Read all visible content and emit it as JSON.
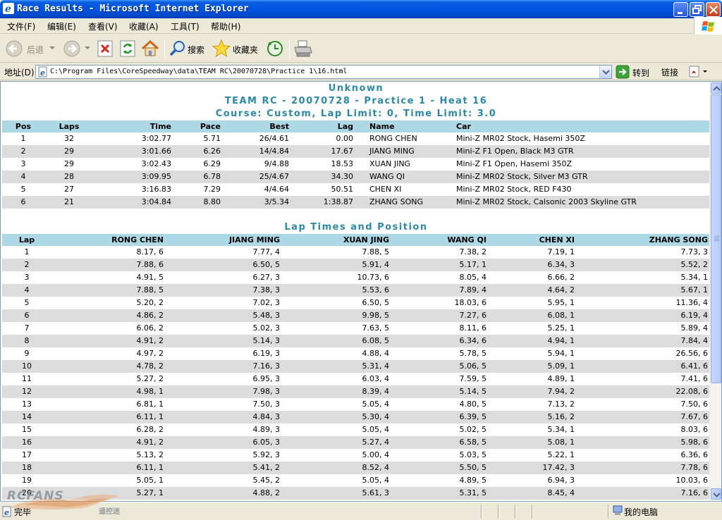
{
  "window": {
    "title": "Race Results - Microsoft Internet Explorer"
  },
  "menu": {
    "items": [
      "文件(F)",
      "编辑(E)",
      "查看(V)",
      "收藏(A)",
      "工具(T)",
      "帮助(H)"
    ]
  },
  "toolbar": {
    "back_label": "后退",
    "search_label": "搜索",
    "favorites_label": "收藏夹"
  },
  "address": {
    "label": "地址(D)",
    "value": "C:\\Program Files\\CoreSpeedway\\data\\TEAM RC\\20070728\\Practice 1\\16.html",
    "go_label": "转到",
    "links_label": "链接"
  },
  "page": {
    "title1": "Unknown",
    "title2": "TEAM RC - 20070728 - Practice 1 - Heat 16",
    "title3": "Course: Custom, Lap Limit: 0, Time Limit: 3.0",
    "results_headers": [
      "Pos",
      "Laps",
      "Time",
      "Pace",
      "Best",
      "Lag",
      "Name",
      "Car"
    ],
    "results": [
      [
        "1",
        "32",
        "3:02.77",
        "5.71",
        "26/4.61",
        "0.00",
        "RONG CHEN",
        "Mini-Z MR02 Stock, Hasemi 350Z"
      ],
      [
        "2",
        "29",
        "3:01.66",
        "6.26",
        "14/4.84",
        "17.67",
        "JIANG MING",
        "Mini-Z F1 Open, Black M3 GTR"
      ],
      [
        "3",
        "29",
        "3:02.43",
        "6.29",
        "9/4.88",
        "18.53",
        "XUAN JING",
        "Mini-Z F1 Open, Hasemi 350Z"
      ],
      [
        "4",
        "28",
        "3:09.95",
        "6.78",
        "25/4.67",
        "34.30",
        "WANG QI",
        "Mini-Z MR02 Stock, Silver M3 GTR"
      ],
      [
        "5",
        "27",
        "3:16.83",
        "7.29",
        "4/4.64",
        "50.51",
        "CHEN XI",
        "Mini-Z MR02 Stock, RED F430"
      ],
      [
        "6",
        "21",
        "3:04.84",
        "8.80",
        "3/5.34",
        "1:38.87",
        "ZHANG SONG",
        "Mini-Z MR02 Stock, Calsonic 2003 Skyline GTR"
      ]
    ],
    "laps_title": "Lap Times and Position",
    "laps_headers": [
      "Lap",
      "RONG CHEN",
      "JIANG MING",
      "XUAN JING",
      "WANG QI",
      "CHEN XI",
      "ZHANG SONG"
    ],
    "laps": [
      [
        "1",
        "8.17, 6",
        "7.77, 4",
        "7.88, 5",
        "7.38, 2",
        "7.19, 1",
        "7.73, 3"
      ],
      [
        "2",
        "7.88, 6",
        "6.50, 5",
        "5.91, 4",
        "5.17, 1",
        "6.34, 3",
        "5.52, 2"
      ],
      [
        "3",
        "4.91, 5",
        "6.27, 3",
        "10.73, 6",
        "8.05, 4",
        "6.66, 2",
        "5.34, 1"
      ],
      [
        "4",
        "7.88, 5",
        "7.38, 3",
        "5.53, 6",
        "7.89, 4",
        "4.64, 2",
        "5.67, 1"
      ],
      [
        "5",
        "5.20, 2",
        "7.02, 3",
        "6.50, 5",
        "18.03, 6",
        "5.95, 1",
        "11.36, 4"
      ],
      [
        "6",
        "4.86, 2",
        "5.48, 3",
        "9.98, 5",
        "7.27, 6",
        "6.08, 1",
        "6.19, 4"
      ],
      [
        "7",
        "6.06, 2",
        "5.02, 3",
        "7.63, 5",
        "8.11, 6",
        "5.25, 1",
        "5.89, 4"
      ],
      [
        "8",
        "4.91, 2",
        "5.14, 3",
        "6.08, 5",
        "6.34, 6",
        "4.94, 1",
        "7.84, 4"
      ],
      [
        "9",
        "4.97, 2",
        "6.19, 3",
        "4.88, 4",
        "5.78, 5",
        "5.94, 1",
        "26.56, 6"
      ],
      [
        "10",
        "4.78, 2",
        "7.16, 3",
        "5.31, 4",
        "5.06, 5",
        "5.09, 1",
        "6.41, 6"
      ],
      [
        "11",
        "5.27, 2",
        "6.95, 3",
        "6.03, 4",
        "7.59, 5",
        "4.89, 1",
        "7.41, 6"
      ],
      [
        "12",
        "4.98, 1",
        "7.98, 3",
        "8.39, 4",
        "5.14, 5",
        "7.94, 2",
        "22.08, 6"
      ],
      [
        "13",
        "6.81, 1",
        "7.50, 3",
        "5.05, 4",
        "4.80, 5",
        "7.13, 2",
        "7.50, 6"
      ],
      [
        "14",
        "6.11, 1",
        "4.84, 3",
        "5.30, 4",
        "6.39, 5",
        "5.16, 2",
        "7.67, 6"
      ],
      [
        "15",
        "6.28, 2",
        "4.89, 3",
        "5.05, 4",
        "5.02, 5",
        "5.34, 1",
        "8.03, 6"
      ],
      [
        "16",
        "4.91, 2",
        "6.05, 3",
        "5.27, 4",
        "6.58, 5",
        "5.08, 1",
        "5.98, 6"
      ],
      [
        "17",
        "5.13, 2",
        "5.92, 3",
        "5.00, 4",
        "5.03, 5",
        "5.22, 1",
        "6.36, 6"
      ],
      [
        "18",
        "6.11, 1",
        "5.41, 2",
        "8.52, 4",
        "5.50, 5",
        "17.42, 3",
        "7.78, 6"
      ],
      [
        "19",
        "5.05, 1",
        "5.45, 2",
        "5.05, 4",
        "4.89, 5",
        "6.94, 3",
        "10.03, 6"
      ],
      [
        "20",
        "5.27, 1",
        "4.88, 2",
        "5.61, 3",
        "5.31, 5",
        "8.45, 4",
        "7.16, 6"
      ]
    ]
  },
  "status": {
    "done": "完毕",
    "zone": "我的电脑"
  },
  "watermark": {
    "text": "RCFANS",
    "sub": "遥控迷"
  },
  "colors": {
    "title_bar": "#0054e3",
    "heading_text": "#2a8aa8",
    "header_row": "#add8e6",
    "alt_row": "#dcdcdc"
  }
}
